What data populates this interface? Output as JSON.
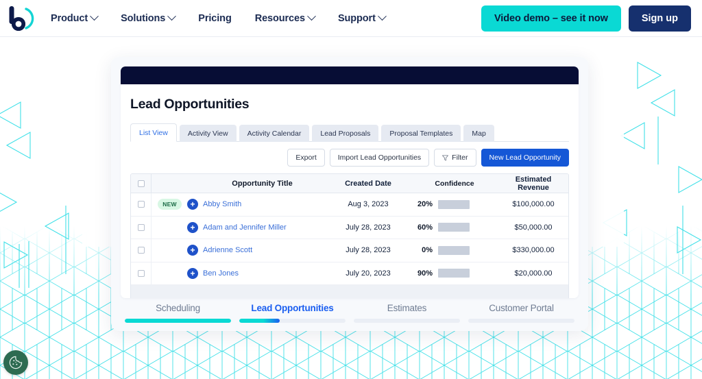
{
  "navbar": {
    "logo_name": "bluefolder-logo",
    "links": [
      {
        "label": "Product",
        "has_chevron": true
      },
      {
        "label": "Solutions",
        "has_chevron": true
      },
      {
        "label": "Pricing",
        "has_chevron": false
      },
      {
        "label": "Resources",
        "has_chevron": true
      },
      {
        "label": "Support",
        "has_chevron": true
      }
    ],
    "demo_button": "Video demo – see it now",
    "signup_button": "Sign up",
    "demo_color": "#0ad9d4",
    "signup_color": "#16306e"
  },
  "app": {
    "header_bar_color": "#070d35",
    "title": "Lead Opportunities",
    "tabs": [
      {
        "label": "List View",
        "active": true
      },
      {
        "label": "Activity View",
        "active": false
      },
      {
        "label": "Activity Calendar",
        "active": false
      },
      {
        "label": "Lead Proposals",
        "active": false
      },
      {
        "label": "Proposal Templates",
        "active": false
      },
      {
        "label": "Map",
        "active": false
      }
    ],
    "toolbar": {
      "export": "Export",
      "import": "Import Lead Opportunities",
      "filter": "Filter",
      "filter_icon": "funnel-icon",
      "new": "New Lead Opportunity",
      "primary_color": "#1557d6"
    },
    "table": {
      "columns": [
        "",
        "",
        "",
        "Opportunity Title",
        "Created Date",
        "Confidence",
        "Estimated Revenue"
      ],
      "headers": {
        "title": "Opportunity Title",
        "date": "Created Date",
        "confidence": "Confidence",
        "revenue": "Estimated Revenue"
      },
      "rows": [
        {
          "badge": "NEW",
          "title": "Abby Smith",
          "date": "Aug 3, 2023",
          "confidence_label": "20%",
          "confidence_value": 20,
          "revenue": "$100,000.00"
        },
        {
          "badge": "",
          "title": "Adam and Jennifer Miller",
          "date": "July 28, 2023",
          "confidence_label": "60%",
          "confidence_value": 60,
          "revenue": "$50,000.00"
        },
        {
          "badge": "",
          "title": "Adrienne Scott",
          "date": "July 28, 2023",
          "confidence_label": "0%",
          "confidence_value": 0,
          "revenue": "$330,000.00"
        },
        {
          "badge": "",
          "title": "Ben Jones",
          "date": "July 20, 2023",
          "confidence_label": "90%",
          "confidence_value": 90,
          "revenue": "$20,000.00"
        }
      ],
      "bar_track_color": "#c8cfdb",
      "bar_fill_color": "#0a4ee0",
      "link_color": "#3a6fd8",
      "badge_bg": "#d8f7e4",
      "badge_fg": "#1b6b46"
    },
    "bottom_tabs": [
      {
        "label": "Scheduling",
        "active": false,
        "progress": 100,
        "fill": "#0ad9d4"
      },
      {
        "label": "Lead Opportunities",
        "active": true,
        "progress": 38,
        "fill": "#0ad9d4"
      },
      {
        "label": "Estimates",
        "active": false,
        "progress": 0,
        "fill": "#eaeef5"
      },
      {
        "label": "Customer Portal",
        "active": false,
        "progress": 0,
        "fill": "#eaeef5"
      }
    ]
  },
  "background": {
    "pattern_color": "#3fe0e8",
    "page_bg": "#ffffff"
  },
  "cookie_widget": {
    "icon": "cookie-icon",
    "color": "#2d6b51"
  }
}
